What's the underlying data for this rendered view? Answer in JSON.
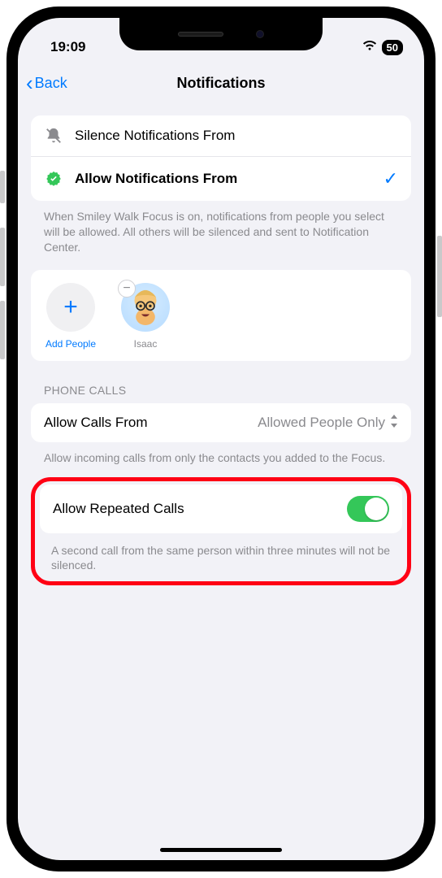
{
  "status": {
    "time": "19:09",
    "battery": "50"
  },
  "nav": {
    "back": "Back",
    "title": "Notifications"
  },
  "silence": {
    "label": "Silence Notifications From"
  },
  "allow": {
    "label": "Allow Notifications From"
  },
  "allow_desc": "When Smiley Walk Focus is on, notifications from people you select will be allowed. All others will be silenced and sent to Notification Center.",
  "people": {
    "add_label": "Add People",
    "items": [
      {
        "name": "Isaac"
      }
    ]
  },
  "phone_header": "PHONE CALLS",
  "calls_from": {
    "label": "Allow Calls From",
    "value": "Allowed People Only"
  },
  "calls_desc": "Allow incoming calls from only the contacts you added to the Focus.",
  "repeated": {
    "label": "Allow Repeated Calls"
  },
  "repeated_desc": "A second call from the same person within three minutes will not be silenced."
}
